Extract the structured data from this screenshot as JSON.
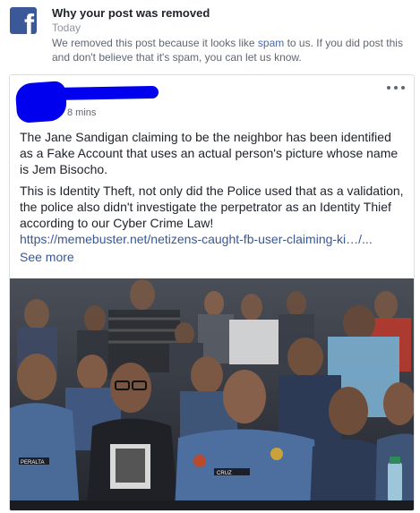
{
  "notice": {
    "icon": "facebook-logo-icon",
    "title": "Why your post was removed",
    "time": "Today",
    "body_before": "We removed this post because it looks like ",
    "body_link": "spam",
    "body_after": " to us. If you did post this and don't believe that it's spam, you can let us know."
  },
  "post": {
    "timestamp": "8 mins",
    "menu_icon": "more-options-icon",
    "paragraph1": "The Jane Sandigan claiming to be the neighbor has been identified as a Fake Account that uses an actual person's picture whose name is Jem Bisocho.",
    "paragraph2": "This is Identity Theft, not only did the Police used that as a validation, the police also didn't investigate the perpetrator as an Identity Thief according to our Cyber Crime Law!",
    "link": "https://memebuster.net/netizens-caught-fb-user-claiming-ki…/...",
    "see_more": "See more",
    "photo": {
      "badge_left": "PERALTA",
      "badge_right": "CRUZ"
    }
  },
  "colors": {
    "brand": "#3b5998",
    "link": "#365899",
    "redaction": "#0000ee",
    "police_uniform": "#4a6a98"
  }
}
